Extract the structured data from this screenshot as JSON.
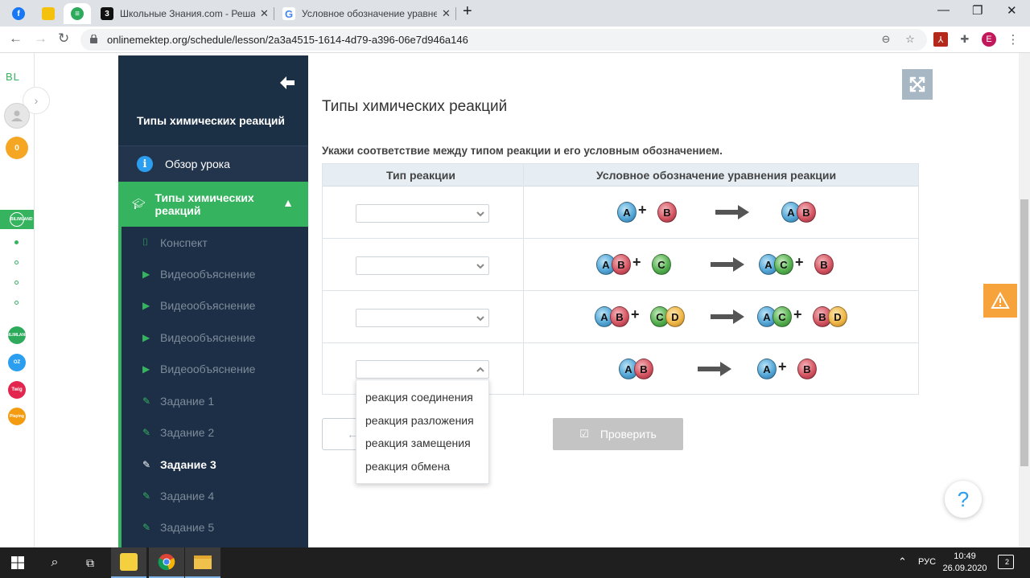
{
  "browser": {
    "tabs": [
      {
        "title": "Школьные Знания.com - Решаю",
        "favicon": "3"
      },
      {
        "title": "Условное обозначение уравнен",
        "favicon": "G"
      }
    ],
    "close_glyph": "✕",
    "new_tab": "+",
    "url": "onlinemektep.org/schedule/lesson/2a3a4515-1614-4d79-a396-06e7d946a146",
    "profile_letter": "E",
    "window": {
      "minimize": "—",
      "restore": "❐",
      "close": "✕"
    }
  },
  "rail": {
    "logo": "BL",
    "coin": "0",
    "apps": [
      "BILIMLAND",
      "OZ",
      "Twig",
      "Playing"
    ]
  },
  "sidebar": {
    "title": "Типы химических реакций",
    "overview": "Обзор урока",
    "section": "Типы химических реакций",
    "items": [
      {
        "label": "Конспект",
        "icon": "book-icon"
      },
      {
        "label": "Видеообъяснение",
        "icon": "play-icon"
      },
      {
        "label": "Видеообъяснение",
        "icon": "play-icon"
      },
      {
        "label": "Видеообъяснение",
        "icon": "play-icon"
      },
      {
        "label": "Видеообъяснение",
        "icon": "play-icon"
      },
      {
        "label": "Задание 1",
        "icon": "edit-icon"
      },
      {
        "label": "Задание 2",
        "icon": "edit-icon"
      },
      {
        "label": "Задание 3",
        "icon": "edit-icon",
        "current": true
      },
      {
        "label": "Задание 4",
        "icon": "edit-icon"
      },
      {
        "label": "Задание 5",
        "icon": "edit-icon"
      }
    ]
  },
  "main": {
    "title": "Типы химических реакций",
    "instruction": "Укажи соответствие между типом реакции и его условным обозначением.",
    "columns": [
      "Тип реакции",
      "Условное обозначение уравнения реакции"
    ],
    "rows": [
      {
        "reactants": [
          [
            "A"
          ],
          [
            "B"
          ]
        ],
        "products": [
          [
            "A",
            "B"
          ]
        ]
      },
      {
        "reactants": [
          [
            "A",
            "B"
          ],
          [
            "C"
          ]
        ],
        "products": [
          [
            "A",
            "C"
          ],
          [
            "B"
          ]
        ]
      },
      {
        "reactants": [
          [
            "A",
            "B"
          ],
          [
            "C",
            "D"
          ]
        ],
        "products": [
          [
            "A",
            "C"
          ],
          [
            "B",
            "D"
          ]
        ]
      },
      {
        "reactants": [
          [
            "A",
            "B"
          ]
        ],
        "products": [
          [
            "A"
          ],
          [
            "B"
          ]
        ]
      }
    ],
    "plus": "+",
    "dropdown_options": [
      "реакция соединения",
      "реакция разложения",
      "реакция замещения",
      "реакция обмена"
    ],
    "check_button": "Проверить",
    "help": "?"
  },
  "taskbar": {
    "lang": "РУС",
    "time": "10:49",
    "date": "26.09.2020",
    "notifications": "2"
  }
}
